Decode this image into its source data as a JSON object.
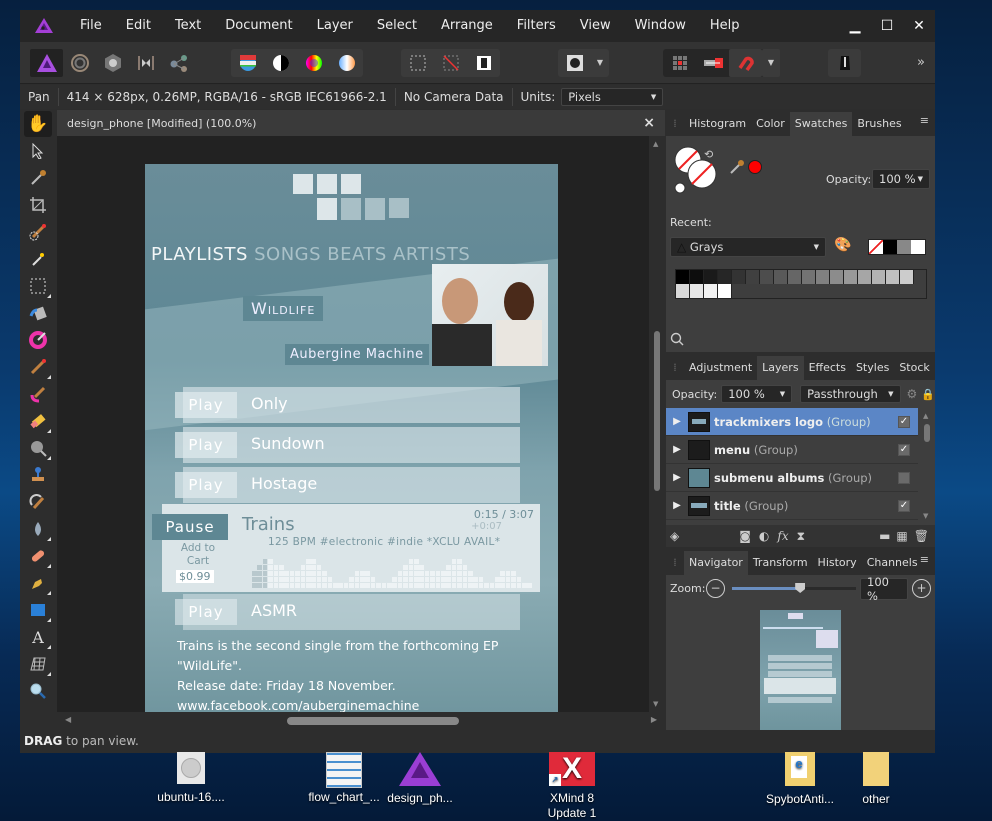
{
  "menu": [
    "File",
    "Edit",
    "Text",
    "Document",
    "Layer",
    "Select",
    "Arrange",
    "Filters",
    "View",
    "Window",
    "Help"
  ],
  "window_controls": {
    "minimize": "▁",
    "maximize": "☐",
    "close": "✕"
  },
  "toolbar": {
    "overflow": "»"
  },
  "context": {
    "tool": "Pan",
    "doc_info": "414 × 628px, 0.26MP, RGBA/16 - sRGB IEC61966-2.1",
    "camera": "No Camera Data",
    "units_label": "Units:",
    "units_value": "Pixels"
  },
  "document": {
    "tab_title": "design_phone [Modified] (100.0%)",
    "close": "×"
  },
  "design": {
    "nav": [
      "PLAYLISTS",
      "SONGS",
      "BEATS",
      "ARTISTS"
    ],
    "album": "Wildlife",
    "artist": "Aubergine Machine",
    "tracks": [
      {
        "action": "Play",
        "title": "Only"
      },
      {
        "action": "Play",
        "title": "Sundown"
      },
      {
        "action": "Play",
        "title": "Hostage"
      }
    ],
    "current": {
      "action": "Pause",
      "title": "Trains",
      "time": "0:15 / 3:07",
      "remaining": "+0:07",
      "tags": "125 BPM #electronic #indie *XCLU AVAIL*",
      "cart_label": "Add to Cart",
      "price": "$0.99"
    },
    "last_track": {
      "action": "Play",
      "title": "ASMR"
    },
    "description": [
      "Trains is the second single from the forthcoming EP",
      "\"WildLife\".",
      "Release date: Friday 18 November.",
      "www.facebook.com/auberginemachine"
    ]
  },
  "status": {
    "bold": "DRAG",
    "text": " to pan view."
  },
  "swatches_panel": {
    "tabs": [
      "Histogram",
      "Color",
      "Swatches",
      "Brushes"
    ],
    "active_tab": "Swatches",
    "opacity_label": "Opacity:",
    "opacity_value": "100 %",
    "recent_label": "Recent:",
    "palette": "Grays",
    "accent_color": "#ff0000"
  },
  "layers_panel": {
    "tabs": [
      "Adjustment",
      "Layers",
      "Effects",
      "Styles",
      "Stock"
    ],
    "active_tab": "Layers",
    "opacity_label": "Opacity:",
    "opacity_value": "100 %",
    "blend_mode": "Passthrough",
    "layers": [
      {
        "name": "trackmixers logo",
        "type": "(Group)",
        "visible": true,
        "selected": true
      },
      {
        "name": "menu",
        "type": "(Group)",
        "visible": true,
        "selected": false
      },
      {
        "name": "submenu albums",
        "type": "(Group)",
        "visible": false,
        "selected": false
      },
      {
        "name": "title",
        "type": "(Group)",
        "visible": true,
        "selected": false
      }
    ]
  },
  "navigator_panel": {
    "tabs": [
      "Navigator",
      "Transform",
      "History",
      "Channels"
    ],
    "active_tab": "Navigator",
    "zoom_label": "Zoom:",
    "zoom_value": "100 %",
    "zoom_fraction": 0.55
  },
  "desktop": [
    {
      "label": "ubuntu-16...."
    },
    {
      "label": "flow_chart_..."
    },
    {
      "label": "design_ph..."
    },
    {
      "label": "XMind 8 Update 1"
    },
    {
      "label": "SpybotAnti..."
    },
    {
      "label": "other"
    }
  ]
}
